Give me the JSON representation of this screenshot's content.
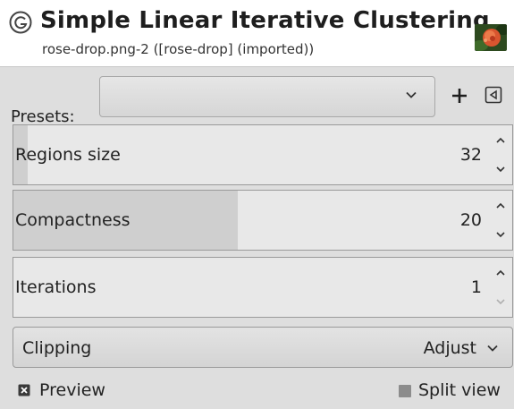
{
  "header": {
    "title": "Simple Linear Iterative Clustering",
    "subtitle": "rose-drop.png-2 ([rose-drop] (imported))",
    "icon": "gegl-icon",
    "thumbnail": "rose-thumbnail"
  },
  "presets": {
    "label": "Presets:",
    "value": "",
    "add_icon": "plus-icon",
    "menu_icon": "menu-left-icon"
  },
  "params": [
    {
      "label": "Regions size",
      "value": "32",
      "level": 0.03
    },
    {
      "label": "Compactness",
      "value": "20",
      "level": 0.47
    },
    {
      "label": "Iterations",
      "value": "1",
      "level": 0.0
    }
  ],
  "clipping": {
    "label": "Clipping",
    "value": "Adjust"
  },
  "toggles": {
    "preview_label": "Preview",
    "preview_checked": true,
    "split_label": "Split view",
    "split_checked": false
  },
  "colors": {
    "background": "#dedede",
    "fill": "#cfcfcf",
    "track": "#e8e8e8"
  }
}
